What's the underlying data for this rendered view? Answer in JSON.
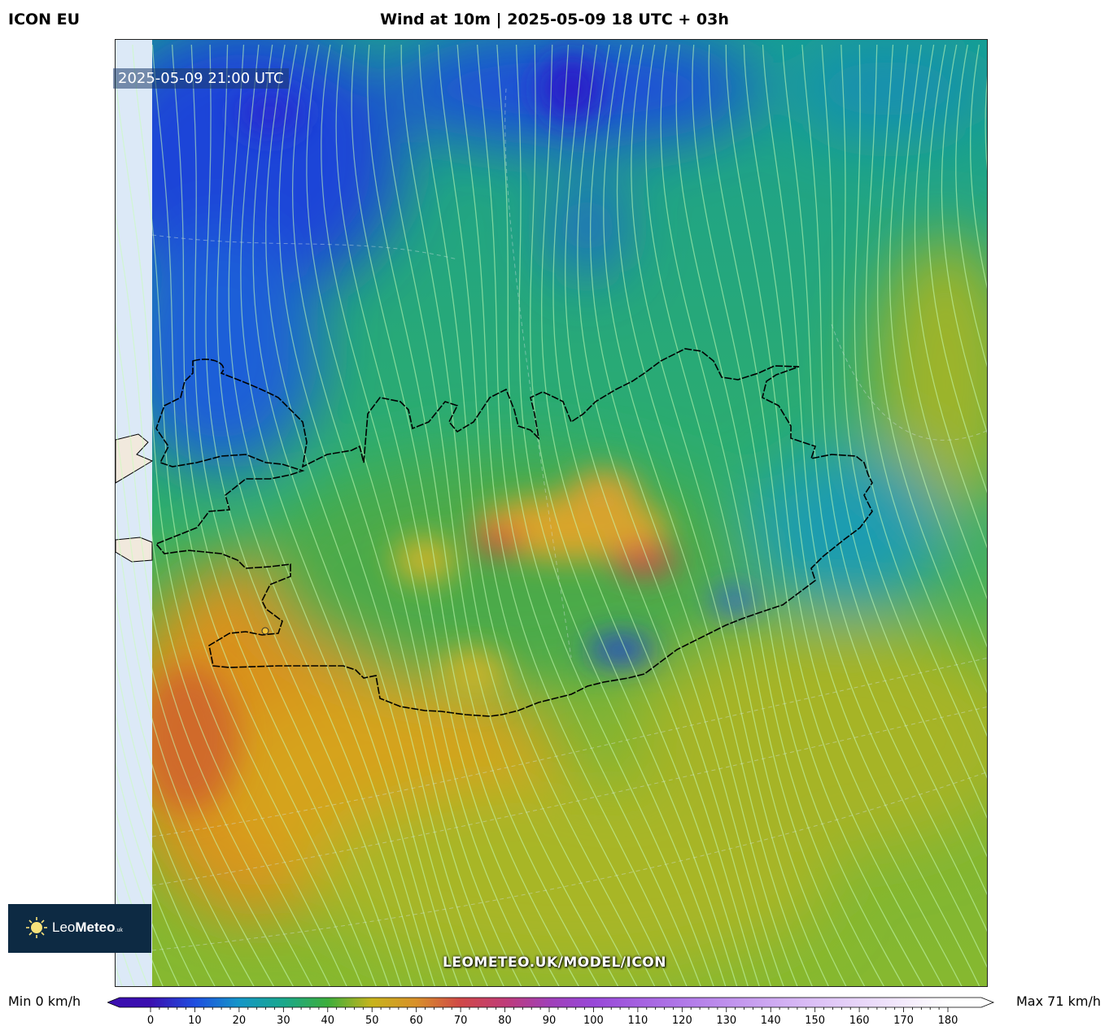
{
  "header": {
    "model": "ICON EU",
    "title": "Wind at 10m | 2025-05-09 18 UTC + 03h"
  },
  "map": {
    "valid_time": "2025-05-09 21:00 UTC",
    "watermark": "LEOMETEO.UK/MODEL/ICON",
    "region": "Iceland",
    "palette": {
      "calm_blue": "#1f45d8",
      "teal": "#18a89a",
      "green": "#35b04a",
      "yellow_green": "#9cb62a",
      "orange": "#d99c1c",
      "red": "#d04848",
      "land_outside": "#f1e9dd",
      "no_data": "#dce9f7"
    }
  },
  "logo": {
    "name_light": "Leo",
    "name_bold": "Meteo",
    "suffix": ".uk"
  },
  "colorbar": {
    "min_label": "Min 0 km/h",
    "max_label": "Max 71 km/h",
    "ticks": [
      "0",
      "10",
      "20",
      "30",
      "40",
      "50",
      "60",
      "70",
      "80",
      "90",
      "100",
      "110",
      "120",
      "130",
      "140",
      "150",
      "160",
      "170",
      "180"
    ],
    "stops": [
      {
        "v": 0,
        "c": "#3b0fb0"
      },
      {
        "v": 10,
        "c": "#1f4ee0"
      },
      {
        "v": 20,
        "c": "#1496c8"
      },
      {
        "v": 30,
        "c": "#1aa88c"
      },
      {
        "v": 40,
        "c": "#3cae3c"
      },
      {
        "v": 50,
        "c": "#c8b41c"
      },
      {
        "v": 60,
        "c": "#d8902a"
      },
      {
        "v": 70,
        "c": "#d04848"
      },
      {
        "v": 80,
        "c": "#c03c78"
      },
      {
        "v": 90,
        "c": "#a040b8"
      },
      {
        "v": 100,
        "c": "#9848d8"
      },
      {
        "v": 120,
        "c": "#b078e8"
      },
      {
        "v": 150,
        "c": "#dcc0f6"
      },
      {
        "v": 180,
        "c": "#ffffff"
      }
    ]
  }
}
